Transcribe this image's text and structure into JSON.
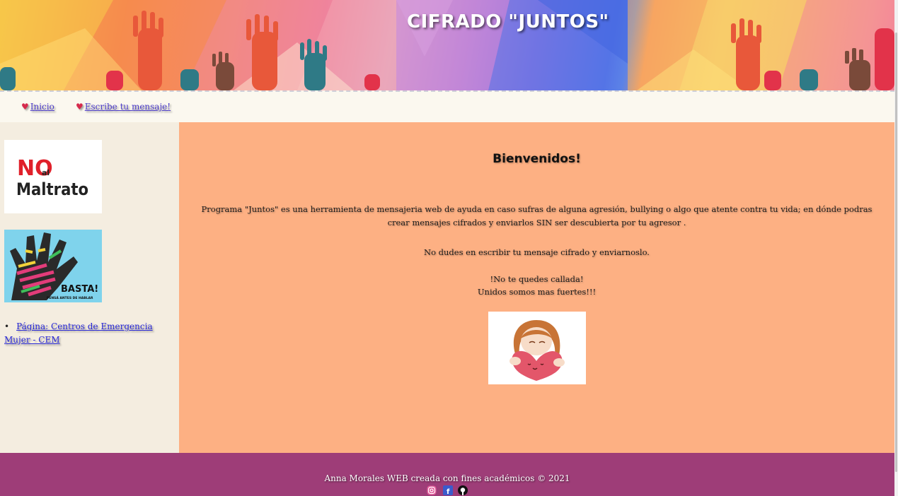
{
  "header": {
    "title": "CIFRADO \"JUNTOS\""
  },
  "nav": {
    "items": [
      {
        "label": "Inicio",
        "icon": "heart-icon"
      },
      {
        "label": "Escribe tu mensaje!",
        "icon": "heart-icon"
      }
    ]
  },
  "sidebar": {
    "images": [
      {
        "name": "no-al-maltrato-image",
        "text_lines": [
          "NO",
          "al",
          "Maltrato"
        ]
      },
      {
        "name": "basta-image",
        "text_lines": [
          "BASTA!",
          "PENSÁ ANTES DE HABLAR"
        ]
      }
    ],
    "link": {
      "label": "Página: Centros de Emergencia Mujer - CEM"
    }
  },
  "main": {
    "heading": "Bienvenidos!",
    "intro": "Programa \"Juntos\" es una herramienta de mensajeria web de ayuda en caso sufras de alguna agresión, bullying o algo que atente contra tu vida; en dónde podras crear mensajes cifrados y enviarlos SIN ser descubierta por tu agresor .",
    "no_dudes": "No dudes en escribir tu mensaje cifrado y enviarnoslo.",
    "callada": "!No te quedes callada!",
    "unidos": "Unidos somos mas fuertes!!!"
  },
  "footer": {
    "text": "Anna Morales WEB creada con fines académicos © 2021",
    "social": [
      "instagram-icon",
      "facebook-icon",
      "github-icon"
    ]
  },
  "colors": {
    "main_bg": "#fdb083",
    "sidebar_bg": "#f4ede0",
    "nav_bg": "#fbf8ef",
    "footer_bg": "#9e3d78",
    "link": "#2626d6"
  }
}
